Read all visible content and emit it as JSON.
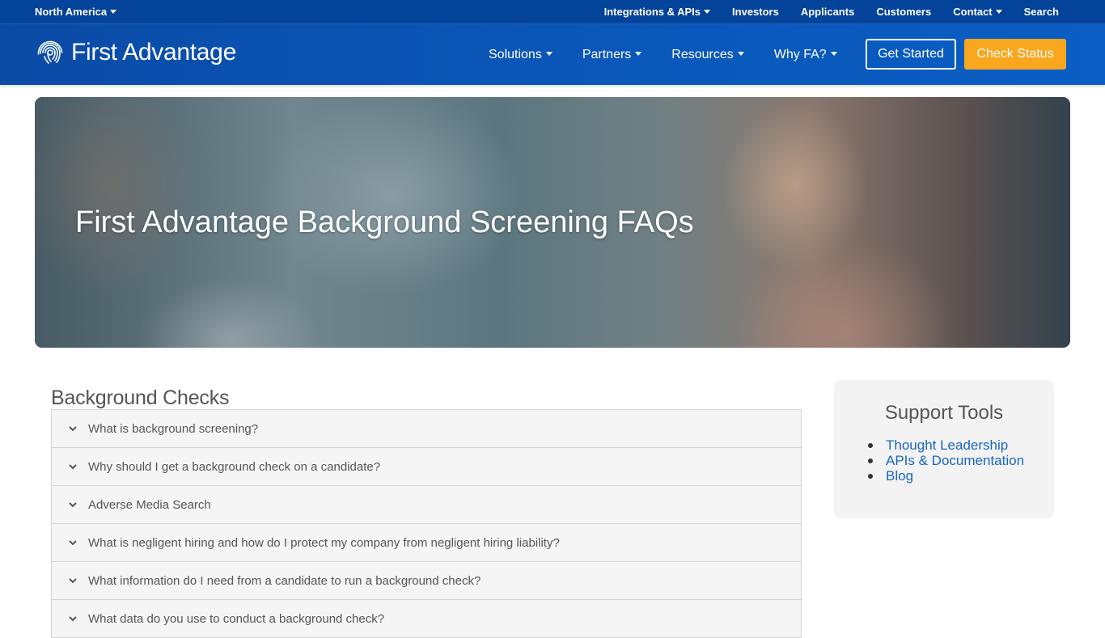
{
  "utility": {
    "region": "North America",
    "links": [
      {
        "label": "Integrations & APIs",
        "has_menu": true
      },
      {
        "label": "Investors",
        "has_menu": false
      },
      {
        "label": "Applicants",
        "has_menu": false
      },
      {
        "label": "Customers",
        "has_menu": false
      },
      {
        "label": "Contact",
        "has_menu": true
      },
      {
        "label": "Search",
        "has_menu": false
      }
    ]
  },
  "header": {
    "logo_text": "First Advantage",
    "nav": [
      {
        "label": "Solutions"
      },
      {
        "label": "Partners"
      },
      {
        "label": "Resources"
      },
      {
        "label": "Why FA?"
      }
    ],
    "get_started_label": "Get Started",
    "check_status_label": "Check Status"
  },
  "hero": {
    "title": "First Advantage Background Screening FAQs"
  },
  "faq": {
    "heading": "Background Checks",
    "items": [
      "What is background screening?",
      "Why should I get a background check on a candidate?",
      "Adverse Media Search",
      "What is negligent hiring and how do I protect my company from negligent hiring liability?",
      "What information do I need from a candidate to run a background check?",
      "What data do you use to conduct a background check?"
    ]
  },
  "support": {
    "title": "Support Tools",
    "links": [
      "Thought Leadership",
      "APIs & Documentation",
      "Blog"
    ]
  },
  "colors": {
    "brand_blue": "#04439a",
    "accent_orange": "#f9a71f",
    "link_blue": "#1a65c1"
  }
}
